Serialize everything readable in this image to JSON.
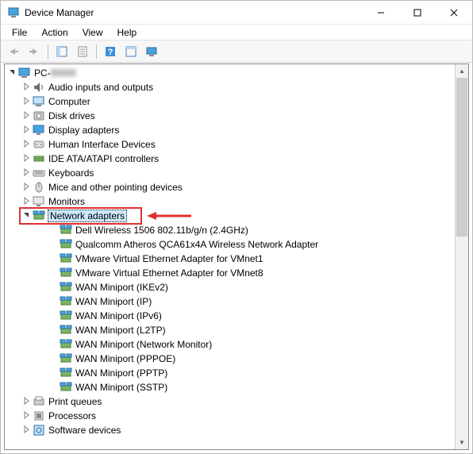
{
  "window": {
    "title": "Device Manager"
  },
  "menu": {
    "file": "File",
    "action": "Action",
    "view": "View",
    "help": "Help"
  },
  "tree": {
    "root": "PC-",
    "categories": [
      {
        "label": "Audio inputs and outputs",
        "expanded": false,
        "icon": "audio"
      },
      {
        "label": "Computer",
        "expanded": false,
        "icon": "computer"
      },
      {
        "label": "Disk drives",
        "expanded": false,
        "icon": "disk"
      },
      {
        "label": "Display adapters",
        "expanded": false,
        "icon": "display"
      },
      {
        "label": "Human Interface Devices",
        "expanded": false,
        "icon": "hid"
      },
      {
        "label": "IDE ATA/ATAPI controllers",
        "expanded": false,
        "icon": "ide"
      },
      {
        "label": "Keyboards",
        "expanded": false,
        "icon": "keyboard"
      },
      {
        "label": "Mice and other pointing devices",
        "expanded": false,
        "icon": "mouse"
      },
      {
        "label": "Monitors",
        "expanded": false,
        "icon": "monitor"
      },
      {
        "label": "Network adapters",
        "expanded": true,
        "icon": "network",
        "selected": true,
        "children": [
          "Dell Wireless 1506 802.11b/g/n (2.4GHz)",
          "Qualcomm Atheros QCA61x4A Wireless Network Adapter",
          "VMware Virtual Ethernet Adapter for VMnet1",
          "VMware Virtual Ethernet Adapter for VMnet8",
          "WAN Miniport (IKEv2)",
          "WAN Miniport (IP)",
          "WAN Miniport (IPv6)",
          "WAN Miniport (L2TP)",
          "WAN Miniport (Network Monitor)",
          "WAN Miniport (PPPOE)",
          "WAN Miniport (PPTP)",
          "WAN Miniport (SSTP)"
        ]
      },
      {
        "label": "Print queues",
        "expanded": false,
        "icon": "printer"
      },
      {
        "label": "Processors",
        "expanded": false,
        "icon": "cpu"
      },
      {
        "label": "Software devices",
        "expanded": false,
        "icon": "software"
      }
    ]
  }
}
